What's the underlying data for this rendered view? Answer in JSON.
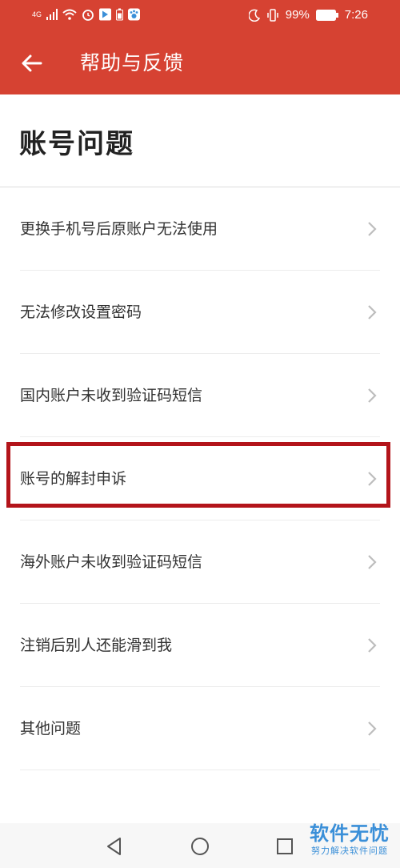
{
  "status_bar": {
    "network_label": "4G",
    "battery_text": "99%",
    "time": "7:26",
    "icons": [
      "signal-icon",
      "wifi-icon",
      "alarm-icon",
      "app-icon",
      "battery-saver-icon",
      "paw-app-icon",
      "moon-icon",
      "vibrate-icon",
      "battery-icon"
    ]
  },
  "app_bar": {
    "title": "帮助与反馈",
    "back_icon": "arrow-left-icon"
  },
  "section": {
    "title": "账号问题"
  },
  "items": [
    {
      "label": "更换手机号后原账户无法使用"
    },
    {
      "label": "无法修改设置密码"
    },
    {
      "label": "国内账户未收到验证码短信"
    },
    {
      "label": "账号的解封申诉"
    },
    {
      "label": "海外账户未收到验证码短信"
    },
    {
      "label": "注销后别人还能滑到我"
    },
    {
      "label": "其他问题"
    }
  ],
  "highlighted_item_index": 3,
  "watermark": {
    "main": "软件无忧",
    "sub": "努力解决软件问题"
  },
  "colors": {
    "app_bar": "#d64232",
    "highlight": "#b3141a",
    "watermark": "#3a8fd8"
  }
}
